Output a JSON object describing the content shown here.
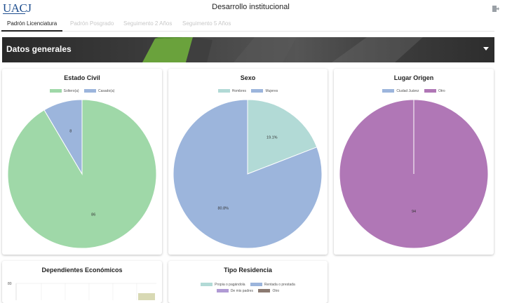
{
  "header": {
    "logo_text": "UACJ",
    "title": "Desarrollo institucional",
    "exit_icon": "logout-icon"
  },
  "tabs": [
    {
      "label": "Padrón Licenciatura",
      "active": true
    },
    {
      "label": "Padrón Posgrado",
      "active": false
    },
    {
      "label": "Seguimento 2 Años",
      "active": false
    },
    {
      "label": "Seguimento 5 Años",
      "active": false
    }
  ],
  "section": {
    "title": "Datos generales",
    "toggle_icon": "chevron-down-icon"
  },
  "cards": {
    "estado_civil": {
      "title": "Estado Civil"
    },
    "sexo": {
      "title": "Sexo"
    },
    "lugar_origen": {
      "title": "Lugar Origen"
    },
    "dependientes": {
      "title": "Dependientes Económicos"
    },
    "residencia": {
      "title": "Tipo Residencia"
    }
  },
  "chart_data": [
    {
      "type": "pie",
      "title": "Estado Civil",
      "categories": [
        "Soltero(a)",
        "Casado(a)"
      ],
      "values": [
        86,
        8
      ],
      "labels": [
        "86",
        "8"
      ],
      "colors": [
        "#9fd8a8",
        "#9cb5dc"
      ]
    },
    {
      "type": "pie",
      "title": "Sexo",
      "categories": [
        "Hombres",
        "Mujeres"
      ],
      "values": [
        19.1,
        80.8
      ],
      "labels": [
        "19.1%",
        "80.8%"
      ],
      "colors": [
        "#b2dad6",
        "#9cb5dc"
      ]
    },
    {
      "type": "pie",
      "title": "Lugar Origen",
      "categories": [
        "Ciudad Juárez",
        "Otro"
      ],
      "values": [
        0,
        94
      ],
      "labels": [
        "",
        "94"
      ],
      "colors": [
        "#9cb5dc",
        "#b077b6"
      ]
    },
    {
      "type": "bar",
      "title": "Dependientes Económicos",
      "y_ticks": [
        "80"
      ],
      "ylim": [
        0,
        80
      ],
      "bar_color": "#d8d9b4"
    },
    {
      "type": "pie",
      "title": "Tipo Residencia",
      "categories": [
        "Propia o pagándola",
        "Rentada o prestada",
        "De mis padres",
        "Otro"
      ],
      "colors": [
        "#b2dad6",
        "#9cb5dc",
        "#b09ad4",
        "#8c7b72"
      ]
    }
  ]
}
